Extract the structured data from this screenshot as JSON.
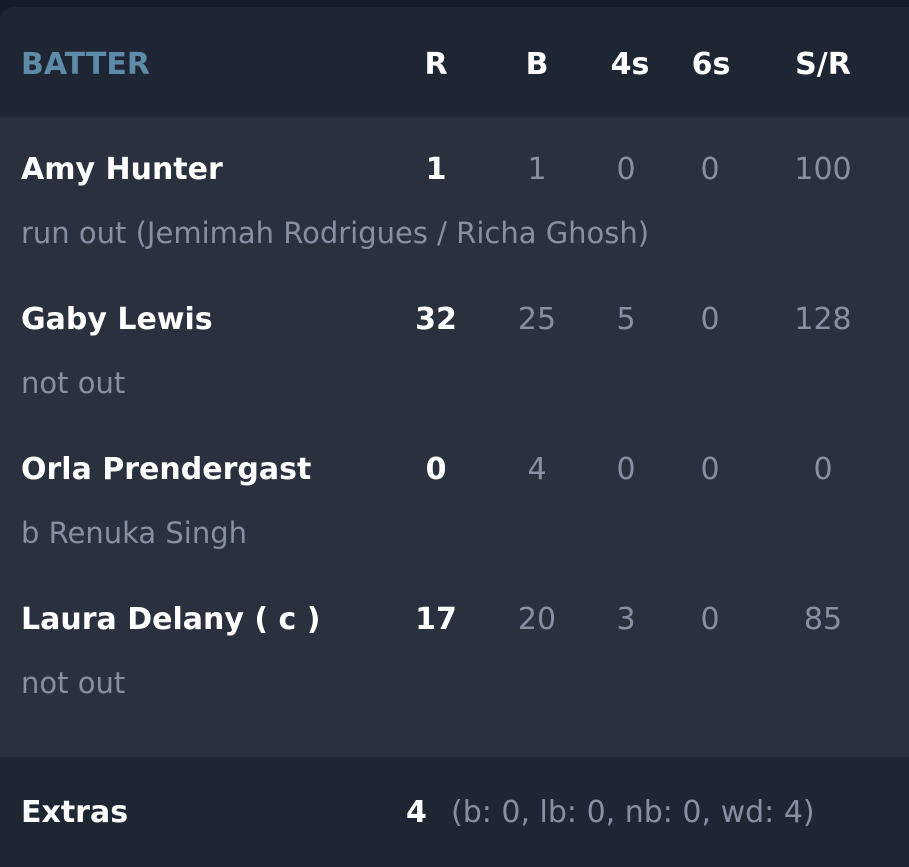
{
  "header": {
    "batter": "BATTER",
    "r": "R",
    "b": "B",
    "fours": "4s",
    "sixes": "6s",
    "sr": "S/R"
  },
  "batters": [
    {
      "name": "Amy Hunter",
      "r": "1",
      "b": "1",
      "fours": "0",
      "sixes": "0",
      "sr": "100",
      "dismissal": "run out (Jemimah Rodrigues / Richa Ghosh)"
    },
    {
      "name": "Gaby Lewis",
      "r": "32",
      "b": "25",
      "fours": "5",
      "sixes": "0",
      "sr": "128",
      "dismissal": "not out"
    },
    {
      "name": "Orla Prendergast",
      "r": "0",
      "b": "4",
      "fours": "0",
      "sixes": "0",
      "sr": "0",
      "dismissal": "b Renuka Singh"
    },
    {
      "name": "Laura Delany ( c )",
      "r": "17",
      "b": "20",
      "fours": "3",
      "sixes": "0",
      "sr": "85",
      "dismissal": "not out"
    }
  ],
  "extras": {
    "label": "Extras",
    "total": "4",
    "detail": "(b: 0, lb: 0, nb: 0, wd: 4)"
  }
}
